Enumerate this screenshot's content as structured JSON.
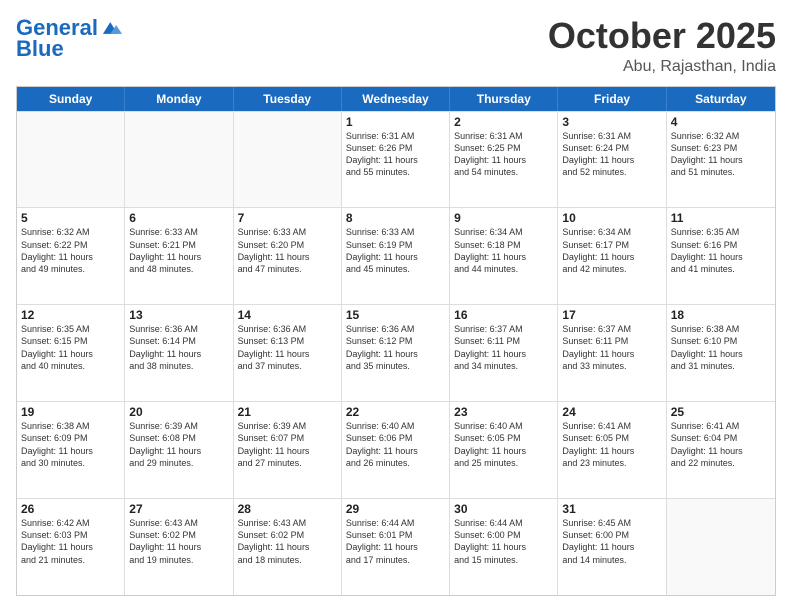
{
  "header": {
    "logo_line1": "General",
    "logo_line2": "Blue",
    "month": "October 2025",
    "location": "Abu, Rajasthan, India"
  },
  "weekdays": [
    "Sunday",
    "Monday",
    "Tuesday",
    "Wednesday",
    "Thursday",
    "Friday",
    "Saturday"
  ],
  "rows": [
    [
      {
        "day": "",
        "text": ""
      },
      {
        "day": "",
        "text": ""
      },
      {
        "day": "",
        "text": ""
      },
      {
        "day": "1",
        "text": "Sunrise: 6:31 AM\nSunset: 6:26 PM\nDaylight: 11 hours\nand 55 minutes."
      },
      {
        "day": "2",
        "text": "Sunrise: 6:31 AM\nSunset: 6:25 PM\nDaylight: 11 hours\nand 54 minutes."
      },
      {
        "day": "3",
        "text": "Sunrise: 6:31 AM\nSunset: 6:24 PM\nDaylight: 11 hours\nand 52 minutes."
      },
      {
        "day": "4",
        "text": "Sunrise: 6:32 AM\nSunset: 6:23 PM\nDaylight: 11 hours\nand 51 minutes."
      }
    ],
    [
      {
        "day": "5",
        "text": "Sunrise: 6:32 AM\nSunset: 6:22 PM\nDaylight: 11 hours\nand 49 minutes."
      },
      {
        "day": "6",
        "text": "Sunrise: 6:33 AM\nSunset: 6:21 PM\nDaylight: 11 hours\nand 48 minutes."
      },
      {
        "day": "7",
        "text": "Sunrise: 6:33 AM\nSunset: 6:20 PM\nDaylight: 11 hours\nand 47 minutes."
      },
      {
        "day": "8",
        "text": "Sunrise: 6:33 AM\nSunset: 6:19 PM\nDaylight: 11 hours\nand 45 minutes."
      },
      {
        "day": "9",
        "text": "Sunrise: 6:34 AM\nSunset: 6:18 PM\nDaylight: 11 hours\nand 44 minutes."
      },
      {
        "day": "10",
        "text": "Sunrise: 6:34 AM\nSunset: 6:17 PM\nDaylight: 11 hours\nand 42 minutes."
      },
      {
        "day": "11",
        "text": "Sunrise: 6:35 AM\nSunset: 6:16 PM\nDaylight: 11 hours\nand 41 minutes."
      }
    ],
    [
      {
        "day": "12",
        "text": "Sunrise: 6:35 AM\nSunset: 6:15 PM\nDaylight: 11 hours\nand 40 minutes."
      },
      {
        "day": "13",
        "text": "Sunrise: 6:36 AM\nSunset: 6:14 PM\nDaylight: 11 hours\nand 38 minutes."
      },
      {
        "day": "14",
        "text": "Sunrise: 6:36 AM\nSunset: 6:13 PM\nDaylight: 11 hours\nand 37 minutes."
      },
      {
        "day": "15",
        "text": "Sunrise: 6:36 AM\nSunset: 6:12 PM\nDaylight: 11 hours\nand 35 minutes."
      },
      {
        "day": "16",
        "text": "Sunrise: 6:37 AM\nSunset: 6:11 PM\nDaylight: 11 hours\nand 34 minutes."
      },
      {
        "day": "17",
        "text": "Sunrise: 6:37 AM\nSunset: 6:11 PM\nDaylight: 11 hours\nand 33 minutes."
      },
      {
        "day": "18",
        "text": "Sunrise: 6:38 AM\nSunset: 6:10 PM\nDaylight: 11 hours\nand 31 minutes."
      }
    ],
    [
      {
        "day": "19",
        "text": "Sunrise: 6:38 AM\nSunset: 6:09 PM\nDaylight: 11 hours\nand 30 minutes."
      },
      {
        "day": "20",
        "text": "Sunrise: 6:39 AM\nSunset: 6:08 PM\nDaylight: 11 hours\nand 29 minutes."
      },
      {
        "day": "21",
        "text": "Sunrise: 6:39 AM\nSunset: 6:07 PM\nDaylight: 11 hours\nand 27 minutes."
      },
      {
        "day": "22",
        "text": "Sunrise: 6:40 AM\nSunset: 6:06 PM\nDaylight: 11 hours\nand 26 minutes."
      },
      {
        "day": "23",
        "text": "Sunrise: 6:40 AM\nSunset: 6:05 PM\nDaylight: 11 hours\nand 25 minutes."
      },
      {
        "day": "24",
        "text": "Sunrise: 6:41 AM\nSunset: 6:05 PM\nDaylight: 11 hours\nand 23 minutes."
      },
      {
        "day": "25",
        "text": "Sunrise: 6:41 AM\nSunset: 6:04 PM\nDaylight: 11 hours\nand 22 minutes."
      }
    ],
    [
      {
        "day": "26",
        "text": "Sunrise: 6:42 AM\nSunset: 6:03 PM\nDaylight: 11 hours\nand 21 minutes."
      },
      {
        "day": "27",
        "text": "Sunrise: 6:43 AM\nSunset: 6:02 PM\nDaylight: 11 hours\nand 19 minutes."
      },
      {
        "day": "28",
        "text": "Sunrise: 6:43 AM\nSunset: 6:02 PM\nDaylight: 11 hours\nand 18 minutes."
      },
      {
        "day": "29",
        "text": "Sunrise: 6:44 AM\nSunset: 6:01 PM\nDaylight: 11 hours\nand 17 minutes."
      },
      {
        "day": "30",
        "text": "Sunrise: 6:44 AM\nSunset: 6:00 PM\nDaylight: 11 hours\nand 15 minutes."
      },
      {
        "day": "31",
        "text": "Sunrise: 6:45 AM\nSunset: 6:00 PM\nDaylight: 11 hours\nand 14 minutes."
      },
      {
        "day": "",
        "text": ""
      }
    ]
  ]
}
